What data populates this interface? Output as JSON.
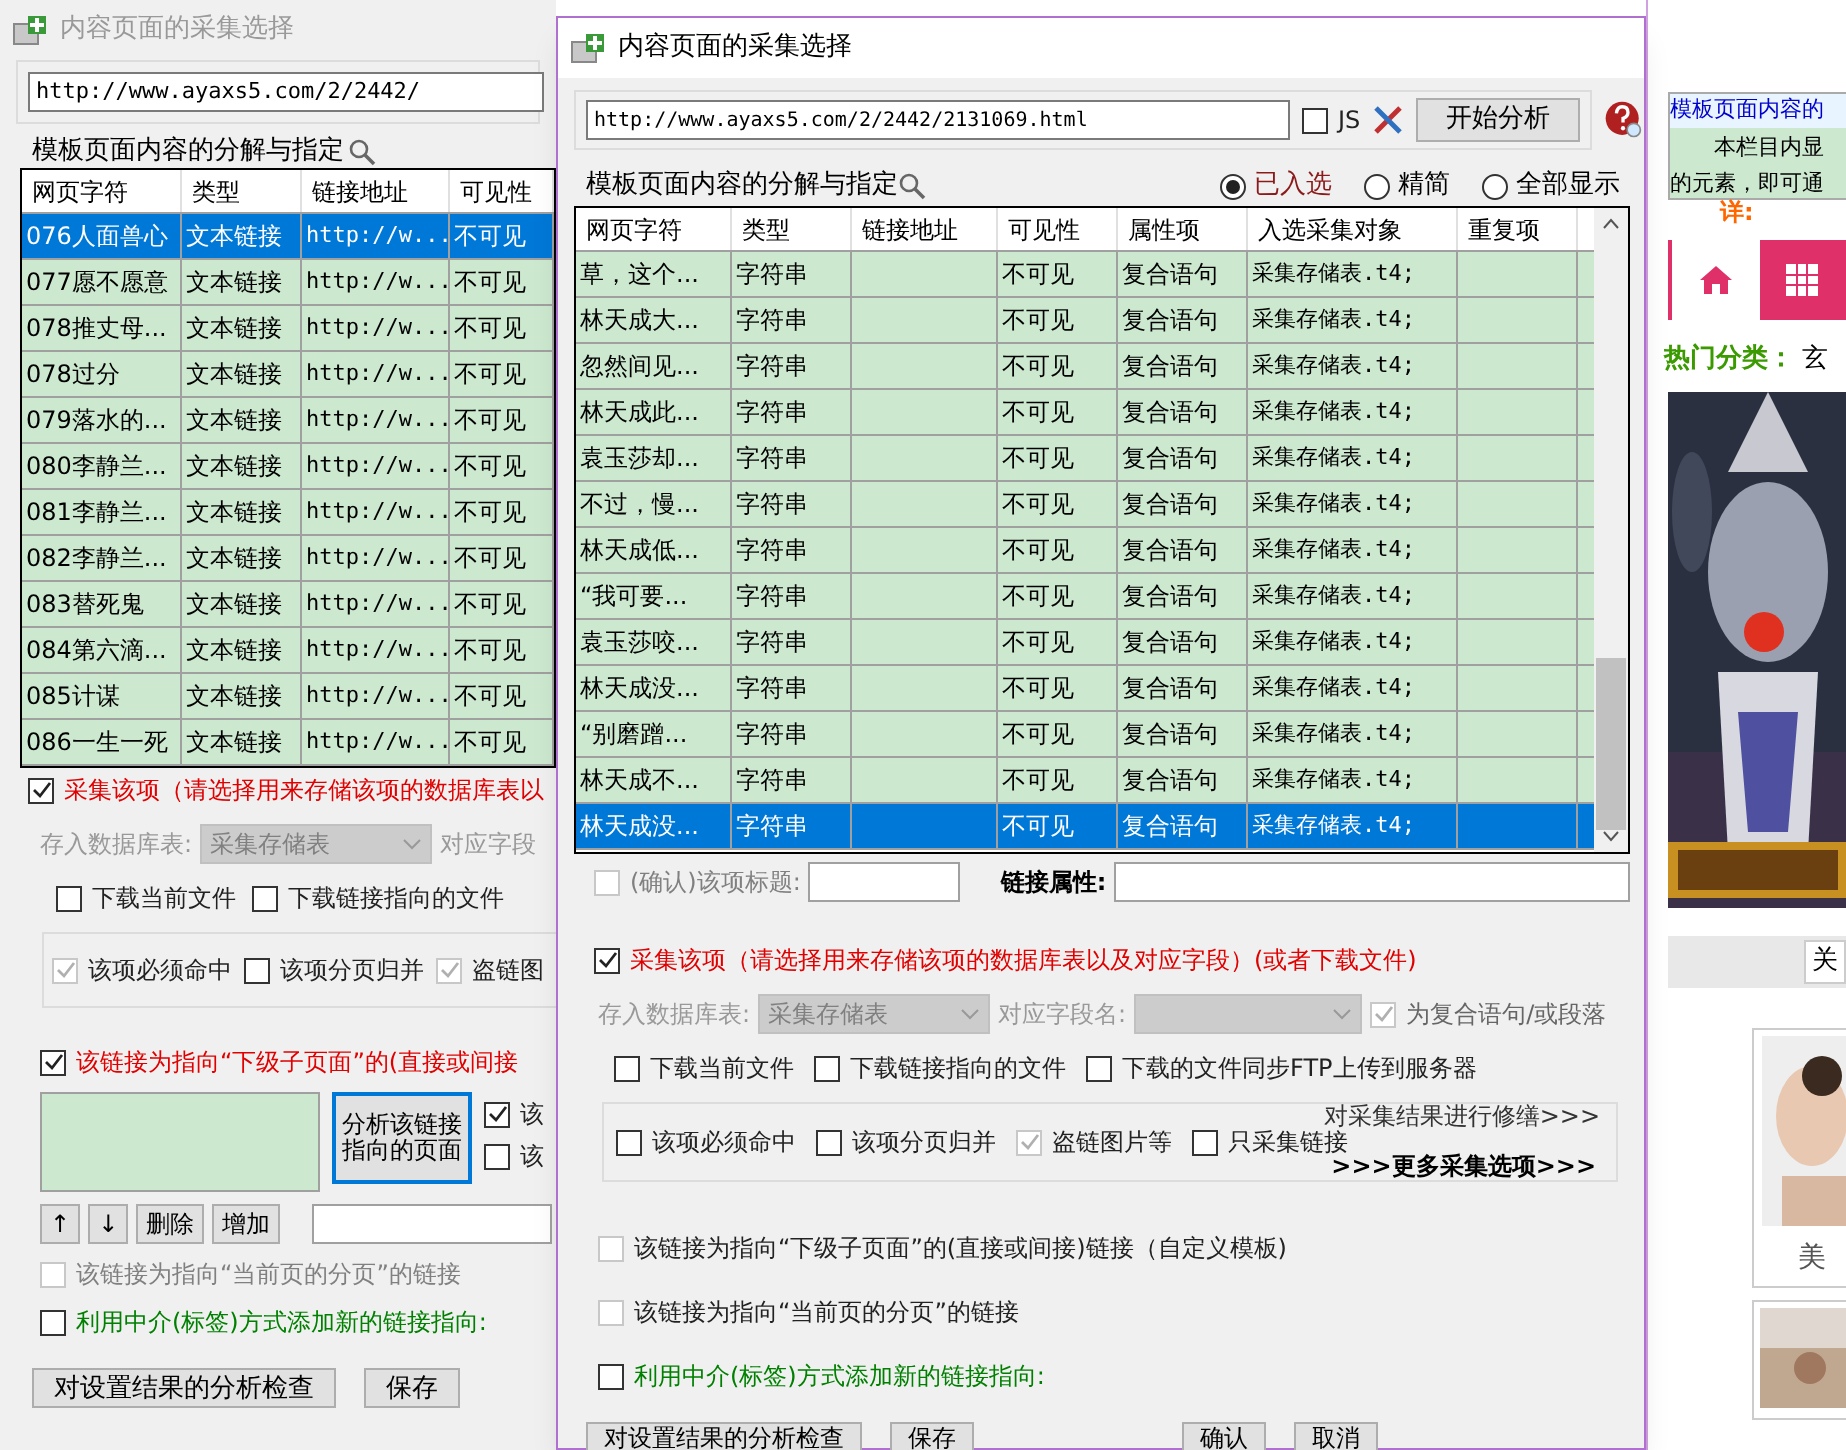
{
  "left_window": {
    "title": "内容页面的采集选择",
    "url": "http://www.ayaxs5.com/2/2442/",
    "group_label": "模板页面内容的分解与指定",
    "columns": [
      "网页字符",
      "类型",
      "链接地址",
      "可见性"
    ],
    "rows": [
      {
        "char": "076人面兽心",
        "type": "文本链接",
        "link": "http://w...",
        "visibility": "不可见",
        "selected": true
      },
      {
        "char": "077愿不愿意",
        "type": "文本链接",
        "link": "http://w...",
        "visibility": "不可见",
        "selected": false
      },
      {
        "char": "078推丈母...",
        "type": "文本链接",
        "link": "http://w...",
        "visibility": "不可见",
        "selected": false
      },
      {
        "char": "078过分",
        "type": "文本链接",
        "link": "http://w...",
        "visibility": "不可见",
        "selected": false
      },
      {
        "char": "079落水的...",
        "type": "文本链接",
        "link": "http://w...",
        "visibility": "不可见",
        "selected": false
      },
      {
        "char": "080李静兰...",
        "type": "文本链接",
        "link": "http://w...",
        "visibility": "不可见",
        "selected": false
      },
      {
        "char": "081李静兰...",
        "type": "文本链接",
        "link": "http://w...",
        "visibility": "不可见",
        "selected": false
      },
      {
        "char": "082李静兰...",
        "type": "文本链接",
        "link": "http://w...",
        "visibility": "不可见",
        "selected": false
      },
      {
        "char": "083替死鬼",
        "type": "文本链接",
        "link": "http://w...",
        "visibility": "不可见",
        "selected": false
      },
      {
        "char": "084第六滴...",
        "type": "文本链接",
        "link": "http://w...",
        "visibility": "不可见",
        "selected": false
      },
      {
        "char": "085计谋",
        "type": "文本链接",
        "link": "http://w...",
        "visibility": "不可见",
        "selected": false
      },
      {
        "char": "086一生一死",
        "type": "文本链接",
        "link": "http://w...",
        "visibility": "不可见",
        "selected": false
      }
    ],
    "collect": {
      "label": "采集该项（请选择用来存储该项的数据库表以",
      "checked": true
    },
    "db_label": "存入数据库表:",
    "db_value": "采集存储表",
    "field_label": "对应字段",
    "downloads": [
      {
        "label": "下载当前文件",
        "checked": false
      },
      {
        "label": "下载链接指向的文件",
        "checked": false
      }
    ],
    "options": [
      {
        "label": "该项必须命中",
        "checked": true,
        "disabled": true
      },
      {
        "label": "该项分页归并",
        "checked": false,
        "disabled": false
      },
      {
        "label": "盗链图",
        "checked": true,
        "disabled": true
      }
    ],
    "sublink": {
      "label": "该链接为指向“下级子页面”的(直接或间接",
      "checked": true
    },
    "analyze_button": "分析该链接指向的页面",
    "side_checks": [
      {
        "label": "该",
        "checked": true
      },
      {
        "label": "该",
        "checked": false
      }
    ],
    "list_buttons": [
      "↑",
      "↓",
      "删除",
      "增加"
    ],
    "paging": {
      "label": "该链接为指向“当前页的分页”的链接",
      "checked": false
    },
    "mediator": {
      "label": "利用中介(标签)方式添加新的链接指向:",
      "checked": false
    },
    "buttons": [
      "对设置结果的分析检查",
      "保存"
    ]
  },
  "right_window": {
    "title": "内容页面的采集选择",
    "url": "http://www.ayaxs5.com/2/2442/2131069.html",
    "js": {
      "label": "JS",
      "checked": false
    },
    "analyze_button": "开始分析",
    "group_label": "模板页面内容的分解与指定",
    "filters": [
      {
        "label": "已入选",
        "selected": true
      },
      {
        "label": "精简",
        "selected": false
      },
      {
        "label": "全部显示",
        "selected": false
      }
    ],
    "columns": [
      "网页字符",
      "类型",
      "链接地址",
      "可见性",
      "属性项",
      "入选采集对象",
      "重复项"
    ],
    "rows": [
      {
        "char": "草，这个...",
        "type": "字符串",
        "visibility": "不可见",
        "attribute": "复合语句",
        "target": "采集存储表.t4;",
        "selected": false
      },
      {
        "char": "林天成大...",
        "type": "字符串",
        "visibility": "不可见",
        "attribute": "复合语句",
        "target": "采集存储表.t4;",
        "selected": false
      },
      {
        "char": "忽然间见...",
        "type": "字符串",
        "visibility": "不可见",
        "attribute": "复合语句",
        "target": "采集存储表.t4;",
        "selected": false
      },
      {
        "char": "林天成此...",
        "type": "字符串",
        "visibility": "不可见",
        "attribute": "复合语句",
        "target": "采集存储表.t4;",
        "selected": false
      },
      {
        "char": "袁玉莎却...",
        "type": "字符串",
        "visibility": "不可见",
        "attribute": "复合语句",
        "target": "采集存储表.t4;",
        "selected": false
      },
      {
        "char": "不过，慢...",
        "type": "字符串",
        "visibility": "不可见",
        "attribute": "复合语句",
        "target": "采集存储表.t4;",
        "selected": false
      },
      {
        "char": "林天成低...",
        "type": "字符串",
        "visibility": "不可见",
        "attribute": "复合语句",
        "target": "采集存储表.t4;",
        "selected": false
      },
      {
        "char": "“我可要...",
        "type": "字符串",
        "visibility": "不可见",
        "attribute": "复合语句",
        "target": "采集存储表.t4;",
        "selected": false
      },
      {
        "char": "袁玉莎咬...",
        "type": "字符串",
        "visibility": "不可见",
        "attribute": "复合语句",
        "target": "采集存储表.t4;",
        "selected": false
      },
      {
        "char": "林天成没...",
        "type": "字符串",
        "visibility": "不可见",
        "attribute": "复合语句",
        "target": "采集存储表.t4;",
        "selected": false
      },
      {
        "char": "“别磨蹭...",
        "type": "字符串",
        "visibility": "不可见",
        "attribute": "复合语句",
        "target": "采集存储表.t4;",
        "selected": false
      },
      {
        "char": "林天成不...",
        "type": "字符串",
        "visibility": "不可见",
        "attribute": "复合语句",
        "target": "采集存储表.t4;",
        "selected": false
      },
      {
        "char": "林天成没...",
        "type": "字符串",
        "visibility": "不可见",
        "attribute": "复合语句",
        "target": "采集存储表.t4;",
        "selected": true
      }
    ],
    "confirm": {
      "label": "(确认)该项标题:",
      "checked": false
    },
    "link_attr_label": "链接属性:",
    "collect": {
      "label": "采集该项（请选择用来存储该项的数据库表以及对应字段）(或者下载文件)",
      "checked": true
    },
    "db_label": "存入数据库表:",
    "db_value": "采集存储表",
    "field_label": "对应字段名:",
    "compound": {
      "label": "为复合语句/或段落",
      "checked": true
    },
    "downloads": [
      {
        "label": "下载当前文件",
        "checked": false
      },
      {
        "label": "下载链接指向的文件",
        "checked": false
      },
      {
        "label": "下载的文件同步FTP上传到服务器",
        "checked": false
      }
    ],
    "options": [
      {
        "label": "该项必须命中",
        "checked": false,
        "disabled": false
      },
      {
        "label": "该项分页归并",
        "checked": false,
        "disabled": false
      },
      {
        "label": "盗链图片等",
        "checked": true,
        "disabled": true
      },
      {
        "label": "只采集链接",
        "checked": false,
        "disabled": false
      }
    ],
    "repair_link": "对采集结果进行修缮>>>",
    "more_link": ">>>更多采集选项>>>",
    "sublink": {
      "label": "该链接为指向“下级子页面”的(直接或间接)链接（自定义模板)",
      "checked": false
    },
    "paging": {
      "label": "该链接为指向“当前页的分页”的链接",
      "checked": false
    },
    "mediator": {
      "label": "利用中介(标签)方式添加新的链接指向:",
      "checked": false
    },
    "buttons": [
      "对设置结果的分析检查",
      "保存",
      "确认",
      "取消"
    ]
  },
  "web_page": {
    "intro_title": "模板页面内容的",
    "intro_lines": [
      "本栏目内显",
      "的元素，即可通"
    ],
    "intro_more": "详:",
    "nav_tabs": [
      {
        "kind": "home",
        "selected": true
      },
      {
        "kind": "grid",
        "selected": false
      }
    ],
    "hot_label": "热门分类：",
    "hot_item": "玄",
    "close_button": "关",
    "thumb_caption": "美"
  }
}
